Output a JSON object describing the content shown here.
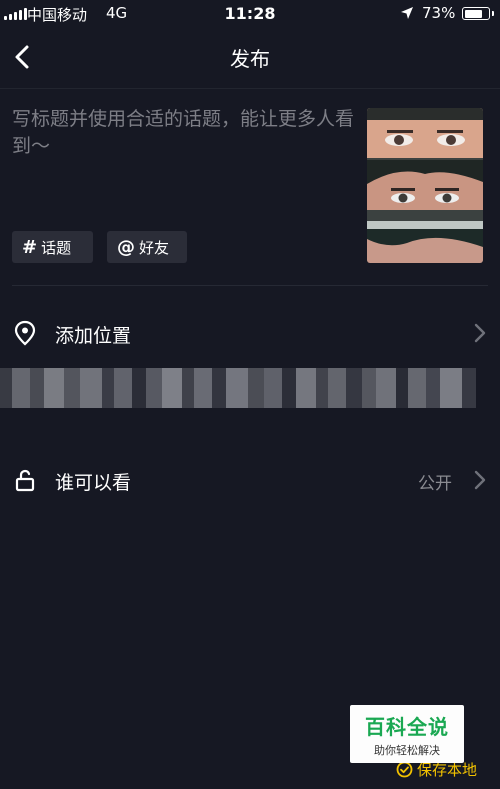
{
  "status_bar": {
    "carrier": "中国移动",
    "network": "4G",
    "time": "11:28",
    "battery": "73%"
  },
  "nav": {
    "title": "发布"
  },
  "caption": {
    "placeholder": "写标题并使用合适的话题，能让更多人看到～"
  },
  "tags": {
    "topic_symbol": "#",
    "topic_label": "话题",
    "friend_symbol": "@",
    "friend_label": "好友"
  },
  "rows": {
    "location_label": "添加位置",
    "visibility_label": "谁可以看",
    "visibility_value": "公开"
  },
  "watermark": {
    "title": "百科全说",
    "subtitle": "助你轻松解决"
  },
  "save_local": {
    "label": "保存本地"
  },
  "colors": {
    "background": "#161823",
    "accent_yellow": "#f2c200",
    "watermark_green": "#1aa852"
  }
}
